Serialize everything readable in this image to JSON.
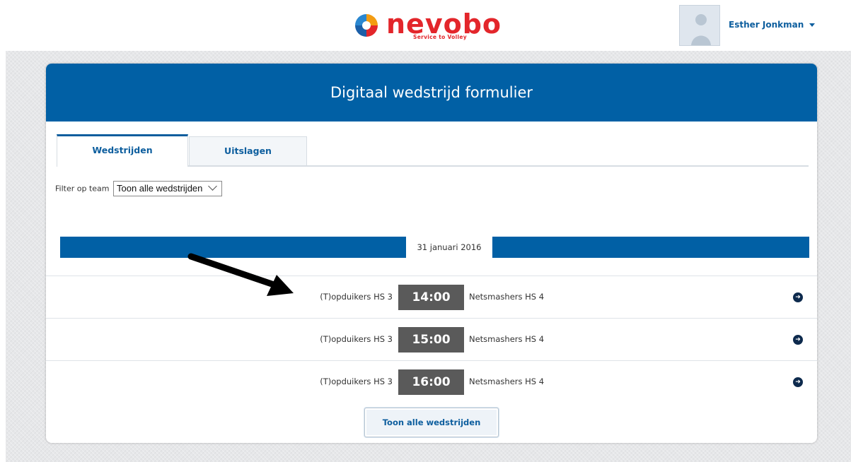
{
  "header": {
    "logo_text": "nevobo",
    "logo_tagline": "Service to Volley",
    "user_name": "Esther Jonkman"
  },
  "card": {
    "title": "Digitaal wedstrijd formulier",
    "tabs": [
      {
        "label": "Wedstrijden",
        "active": true
      },
      {
        "label": "Uitslagen",
        "active": false
      }
    ],
    "filter": {
      "label": "Filter op team",
      "selected": "Toon alle wedstrijden"
    },
    "date": "31 januari 2016",
    "matches": [
      {
        "home": "(T)opduikers HS 3",
        "time": "14:00",
        "away": "Netsmashers HS 4"
      },
      {
        "home": "(T)opduikers HS 3",
        "time": "15:00",
        "away": "Netsmashers HS 4"
      },
      {
        "home": "(T)opduikers HS 3",
        "time": "16:00",
        "away": "Netsmashers HS 4"
      }
    ],
    "show_all_button": "Toon alle wedstrijden"
  },
  "colors": {
    "primary_blue": "#0160a5",
    "brand_red": "#e3262b",
    "time_badge": "#5a5a5a"
  },
  "icons": {
    "row_action": "arrow-right-circle-icon",
    "user_menu": "caret-down-icon"
  }
}
